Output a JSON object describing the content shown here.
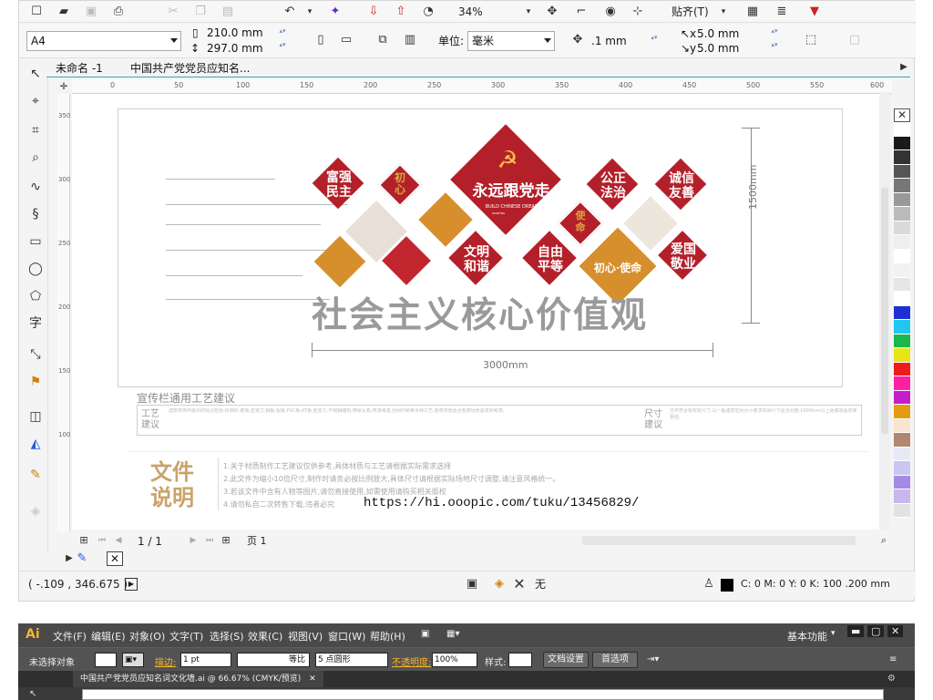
{
  "corel": {
    "toolbar": {
      "zoom": "34%",
      "snap_label": "贴齐(T)"
    },
    "propbar": {
      "page_size": "A4",
      "width": "210.0 mm",
      "height": "297.0 mm",
      "unit_label": "单位:",
      "unit_value": "毫米",
      "nudge": ".1 mm",
      "dup_x": "5.0 mm",
      "dup_y": "5.0 mm"
    },
    "tabs": [
      "未命名 -1",
      "中国共产党党员应知名..."
    ],
    "ruler_h_ticks": [
      "0",
      "50",
      "100",
      "150",
      "200",
      "250",
      "300",
      "350",
      "400",
      "450",
      "500",
      "550",
      "600"
    ],
    "ruler_v_ticks": [
      "350",
      "300",
      "250",
      "200",
      "150",
      "100"
    ],
    "artwork": {
      "center_title": "永远跟党走",
      "center_sub": "BUILD CHINESE DREAM",
      "center_sub2": "WANTING",
      "values": [
        {
          "text": "富强\n民主"
        },
        {
          "text": "初\n心"
        },
        {
          "text": "文明\n和谐"
        },
        {
          "text": "自由\n平等"
        },
        {
          "text": "使\n命"
        },
        {
          "text": "公正\n法治"
        },
        {
          "text": "诚信\n友善"
        },
        {
          "text": "爱国\n敬业"
        },
        {
          "text": "初心·使命"
        }
      ],
      "big_title": "社会主义核心价值观",
      "dim_height": "1500mm",
      "dim_width": "3000mm"
    },
    "spec": {
      "title": "宣传栏通用工艺建议",
      "left_label": "工艺\n建议",
      "right_label": "尺寸\n建议",
      "left_body": "建筑类饰件展示的情况包括:标准的,玻璃,亚克力,钢板,铝板,PVC板,KT板,亚克力,不锈钢雕刻,喷绘写真,喷漆烤漆,丝网印刷等多种工艺,各类背景适合各类场景需求的考虑。",
      "right_body": "文件符合有限定尺寸,以一般建筑空间大小要求实际尺寸适当调整,1000mm以上距离观看效果更佳。"
    },
    "fileinfo": {
      "title": "文件\n说明",
      "lines": [
        "1.关于材质制作工艺建议仅供参考,具体材质与工艺请根据实际需求选择",
        "2.此文件为缩小10倍尺寸,制作时请务必按比例放大,具体尺寸请根据实际场地尺寸调整,请注意风格统一。",
        "3.若该文件中含有人物等图片,请勿直接使用,如需使用请购买相关版权",
        "4.请勿私自二次转售下载,违者必究"
      ],
      "url": "https://hi.ooopic.com/tuku/13456829/"
    },
    "pagenav": {
      "counter": "1 / 1",
      "page_label": "页 1"
    },
    "status": {
      "coords": "( -.109 , 346.675 )",
      "fill_label": "无",
      "outline": "C: 0 M: 0 Y: 0 K: 100  .200 mm"
    },
    "palette": [
      "#ffffff",
      "#1a1a1a",
      "#333333",
      "#555555",
      "#777777",
      "#999999",
      "#bbbbbb",
      "#d9d9d9",
      "#eeeeee",
      "#ffffff",
      "#f2f2f2",
      "#e6e6e6",
      "#ffffff",
      "#1e2fd6",
      "#22c7f0",
      "#19b84a",
      "#e6e617",
      "#f21b1b",
      "#ff1fa3",
      "#c61cc9",
      "#e39c12",
      "#f8e4d2",
      "#b08870",
      "#e8e8f8",
      "#c8c8f0",
      "#a58be6",
      "#c7b7ee",
      "#e2e2e2"
    ]
  },
  "illustrator": {
    "logo": "Ai",
    "menus": [
      "文件(F)",
      "编辑(E)",
      "对象(O)",
      "文字(T)",
      "选择(S)",
      "效果(C)",
      "视图(V)",
      "窗口(W)",
      "帮助(H)"
    ],
    "workspace": "基本功能",
    "control": {
      "no_selection": "未选择对象",
      "stroke_label": "描边:",
      "stroke_value": "1 pt",
      "stroke_style": "等比",
      "brush": "5 点圆形",
      "opacity_label": "不透明度:",
      "opacity_value": "100%",
      "style_label": "样式:",
      "doc_setup": "文档设置",
      "prefs": "首选项"
    },
    "doc_tab": "中国共产党党员应知名词文化墙.ai @ 66.67% (CMYK/预览)"
  }
}
